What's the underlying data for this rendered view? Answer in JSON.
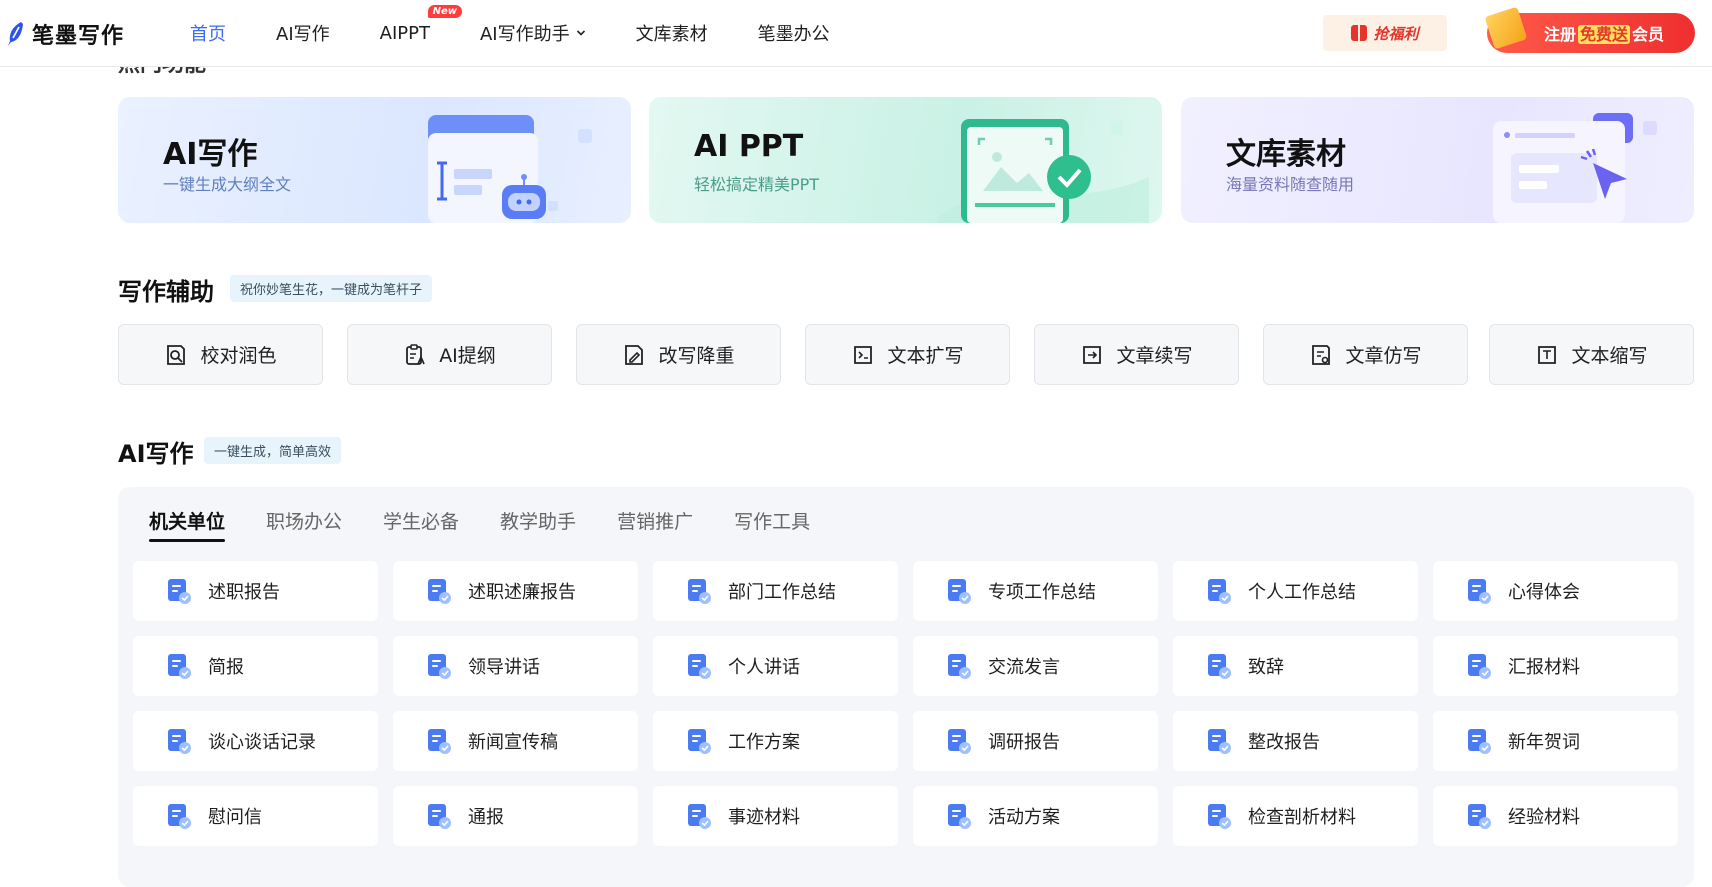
{
  "header": {
    "logo_text": "笔墨写作",
    "nav": [
      {
        "label": "首页",
        "active": true
      },
      {
        "label": "AI写作"
      },
      {
        "label": "AIPPT",
        "badge": "New"
      },
      {
        "label": "AI写作助手",
        "dropdown": true
      },
      {
        "label": "文库素材"
      },
      {
        "label": "笔墨办公"
      }
    ],
    "promo_label": "抢福利",
    "register": {
      "part1": "注册",
      "highlight": "免费送",
      "part2": "会员"
    }
  },
  "hot_section_title": "热门功能",
  "feature_cards": [
    {
      "title": "AI写作",
      "subtitle": "一键生成大纲全文",
      "icon": "folder-robot-icon"
    },
    {
      "title": "AI PPT",
      "subtitle": "轻松搞定精美PPT",
      "icon": "slide-check-icon"
    },
    {
      "title": "文库素材",
      "subtitle": "海量资料随查随用",
      "icon": "document-cursor-icon"
    }
  ],
  "assist_section": {
    "title": "写作辅助",
    "tag": "祝你妙笔生花，一键成为笔杆子",
    "tools": [
      {
        "label": "校对润色",
        "icon": "proofread-icon"
      },
      {
        "label": "AI提纲",
        "icon": "outline-icon"
      },
      {
        "label": "改写降重",
        "icon": "rewrite-icon"
      },
      {
        "label": "文本扩写",
        "icon": "expand-text-icon"
      },
      {
        "label": "文章续写",
        "icon": "continue-writing-icon"
      },
      {
        "label": "文章仿写",
        "icon": "imitate-writing-icon"
      },
      {
        "label": "文本缩写",
        "icon": "abbreviate-text-icon"
      }
    ]
  },
  "ai_section": {
    "title": "AI写作",
    "tag": "一键生成，简单高效",
    "tabs": [
      {
        "label": "机关单位",
        "active": true
      },
      {
        "label": "职场办公"
      },
      {
        "label": "学生必备"
      },
      {
        "label": "教学助手"
      },
      {
        "label": "营销推广"
      },
      {
        "label": "写作工具"
      }
    ],
    "items": [
      "述职报告",
      "述职述廉报告",
      "部门工作总结",
      "专项工作总结",
      "个人工作总结",
      "心得体会",
      "简报",
      "领导讲话",
      "个人讲话",
      "交流发言",
      "致辞",
      "汇报材料",
      "谈心谈话记录",
      "新闻宣传稿",
      "工作方案",
      "调研报告",
      "整改报告",
      "新年贺词",
      "慰问信",
      "通报",
      "事迹材料",
      "活动方案",
      "检查剖析材料",
      "经验材料"
    ]
  },
  "colors": {
    "accent": "#3b6cf6",
    "register": "#ee2f2f",
    "panel": "#f4f6f9"
  }
}
